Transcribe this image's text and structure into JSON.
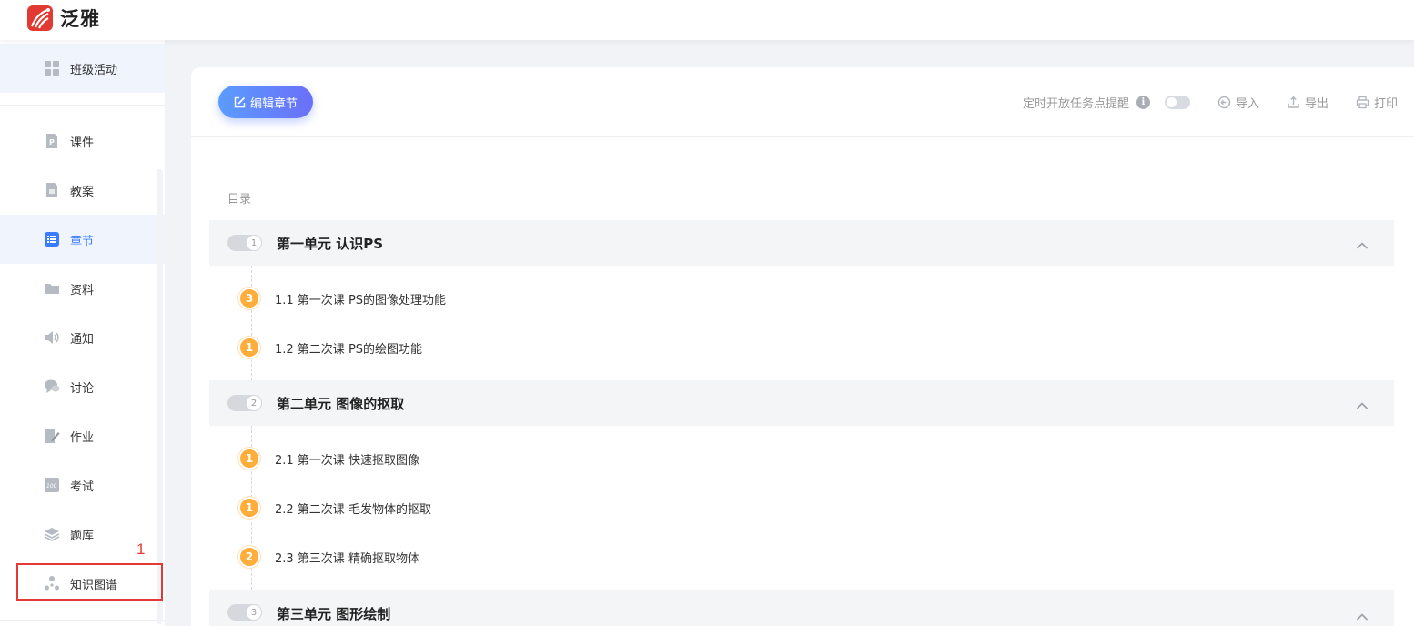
{
  "app": {
    "name": "泛雅",
    "brand_color": "#e23a33",
    "accent": "#3a7bff"
  },
  "sidebar": {
    "items": [
      {
        "label": "班级活动",
        "icon": "grid-icon"
      },
      {
        "label": "课件",
        "icon": "courseware-icon"
      },
      {
        "label": "教案",
        "icon": "lesson-plan-icon"
      },
      {
        "label": "章节",
        "icon": "list-icon",
        "active": true
      },
      {
        "label": "资料",
        "icon": "folder-icon"
      },
      {
        "label": "通知",
        "icon": "speaker-icon"
      },
      {
        "label": "讨论",
        "icon": "chat-icon"
      },
      {
        "label": "作业",
        "icon": "homework-icon"
      },
      {
        "label": "考试",
        "icon": "exam-icon"
      },
      {
        "label": "题库",
        "icon": "layers-icon"
      },
      {
        "label": "知识图谱",
        "icon": "graph-icon"
      }
    ]
  },
  "annotation": {
    "number": "1"
  },
  "toolbar": {
    "edit_label": "编辑章节",
    "timer_label": "定时开放任务点提醒",
    "info_glyph": "i",
    "import_label": "导入",
    "export_label": "导出",
    "print_label": "打印"
  },
  "toc": {
    "label": "目录",
    "units": [
      {
        "num": "1",
        "title": "第一单元 认识PS",
        "lessons": [
          {
            "badge": "3",
            "title": "1.1 第一次课 PS的图像处理功能"
          },
          {
            "badge": "1",
            "title": "1.2 第二次课 PS的绘图功能"
          }
        ]
      },
      {
        "num": "2",
        "title": "第二单元 图像的抠取",
        "lessons": [
          {
            "badge": "1",
            "title": "2.1 第一次课 快速抠取图像"
          },
          {
            "badge": "1",
            "title": "2.2 第二次课 毛发物体的抠取"
          },
          {
            "badge": "2",
            "title": "2.3 第三次课 精确抠取物体"
          }
        ]
      },
      {
        "num": "3",
        "title": "第三单元 图形绘制",
        "lessons": []
      }
    ]
  }
}
